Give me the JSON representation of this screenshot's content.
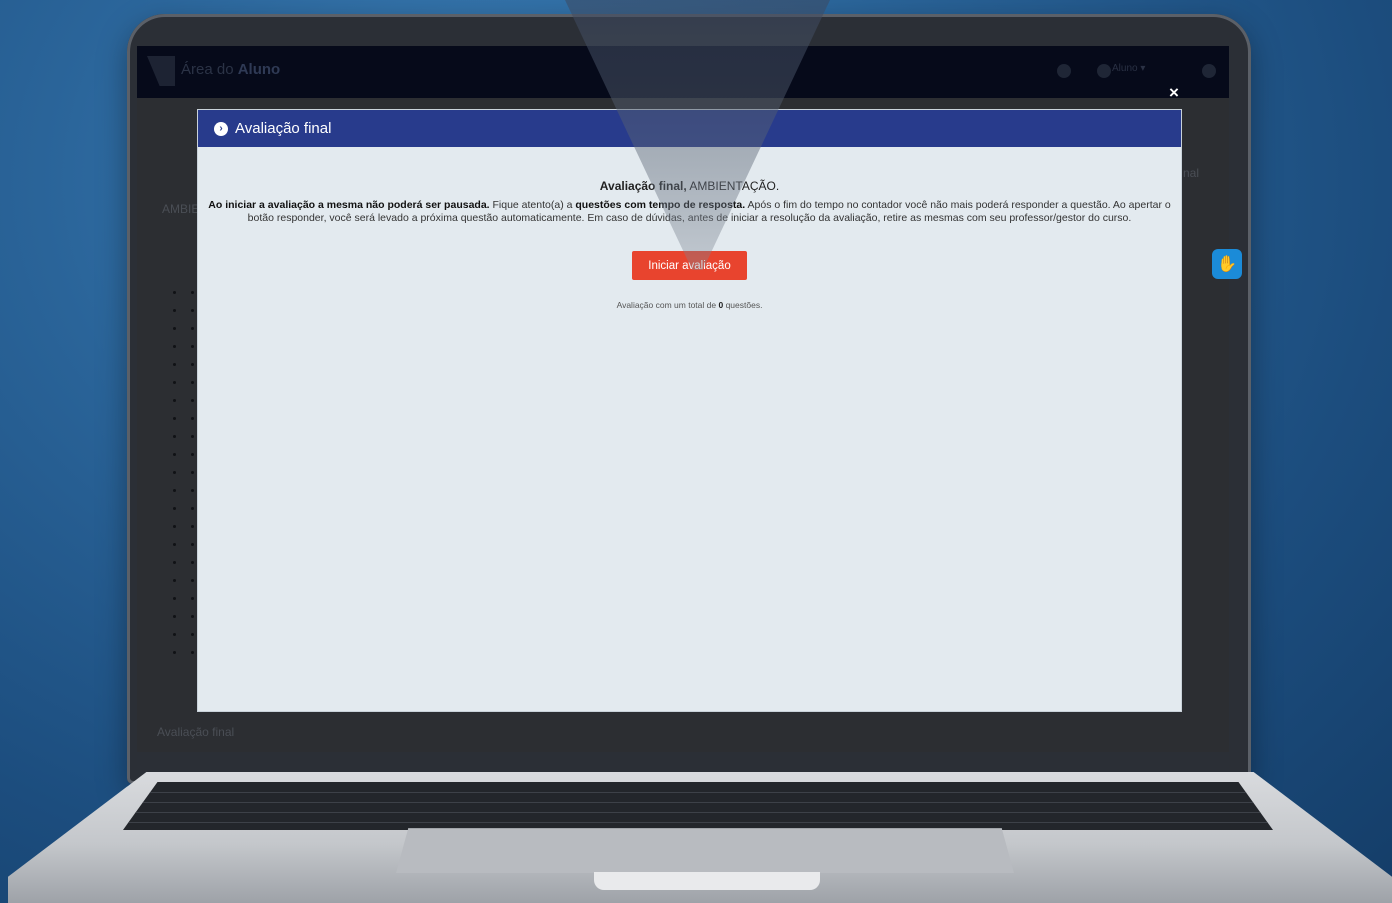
{
  "app": {
    "title_prefix": "Área do",
    "title_bold": "Aluno",
    "user_label": "Aluno ▾"
  },
  "background_page": {
    "left_label": "AMBIE",
    "right_label": "nal",
    "footer_label": "Avaliação final"
  },
  "modal": {
    "title": "Avaliação final",
    "close_label": "×",
    "heading_bold": "Avaliação final,",
    "heading_rest": " AMBIENTAÇÃO.",
    "instructions": {
      "p1_bold": "Ao iniciar a avaliação a mesma não poderá ser pausada.",
      "p2": " Fique atento(a) a ",
      "p3_bold": "questões com tempo de resposta.",
      "p4": " Após o fim do tempo no contador você não mais poderá responder a questão. Ao apertar o botão responder, você será levado a próxima questão automaticamente. Em caso de dúvidas, antes de iniciar a resolução da avaliação, retire as mesmas com seu professor/gestor do curso."
    },
    "start_button": "Iniciar avaliação",
    "total_prefix": "Avaliação com um total de ",
    "total_count": "0",
    "total_suffix": " questões."
  },
  "colors": {
    "modal_header": "#283b8c",
    "start_button": "#e8442e",
    "side_badge": "#1b8bd8"
  },
  "icons": {
    "modal_header": "chevron-right-circle-icon",
    "side_badge": "accessibility-hand-icon",
    "bell": "bell-icon",
    "user": "user-icon",
    "chat": "chat-icon"
  }
}
